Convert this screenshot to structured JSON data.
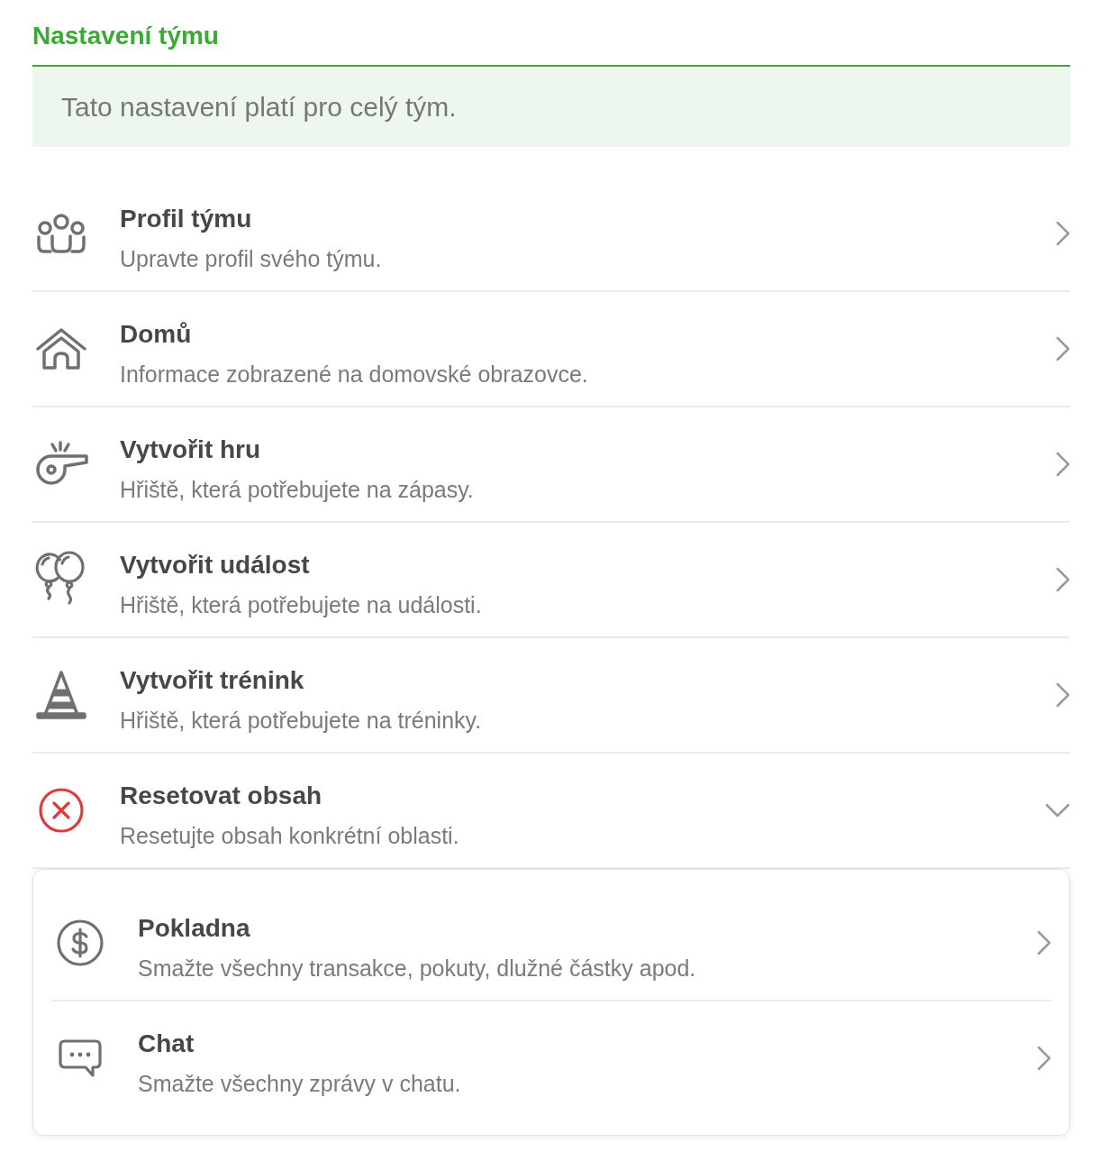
{
  "title": "Nastavení týmu",
  "notice": "Tato nastavení platí pro celý tým.",
  "items": [
    {
      "title": "Profil týmu",
      "description": "Upravte profil svého týmu.",
      "expanded": false
    },
    {
      "title": "Domů",
      "description": "Informace zobrazené na domovské obrazovce.",
      "expanded": false
    },
    {
      "title": "Vytvořit hru",
      "description": "Hřiště, která potřebujete na zápasy.",
      "expanded": false
    },
    {
      "title": "Vytvořit událost",
      "description": "Hřiště, která potřebujete na události.",
      "expanded": false
    },
    {
      "title": "Vytvořit trénink",
      "description": "Hřiště, která potřebujete na tréninky.",
      "expanded": false
    },
    {
      "title": "Resetovat obsah",
      "description": "Resetujte obsah konkrétní oblasti.",
      "expanded": true,
      "children": [
        {
          "title": "Pokladna",
          "description": "Smažte všechny transakce, pokuty, dlužné částky apod."
        },
        {
          "title": "Chat",
          "description": "Smažte všechny zprávy v chatu."
        }
      ]
    }
  ]
}
